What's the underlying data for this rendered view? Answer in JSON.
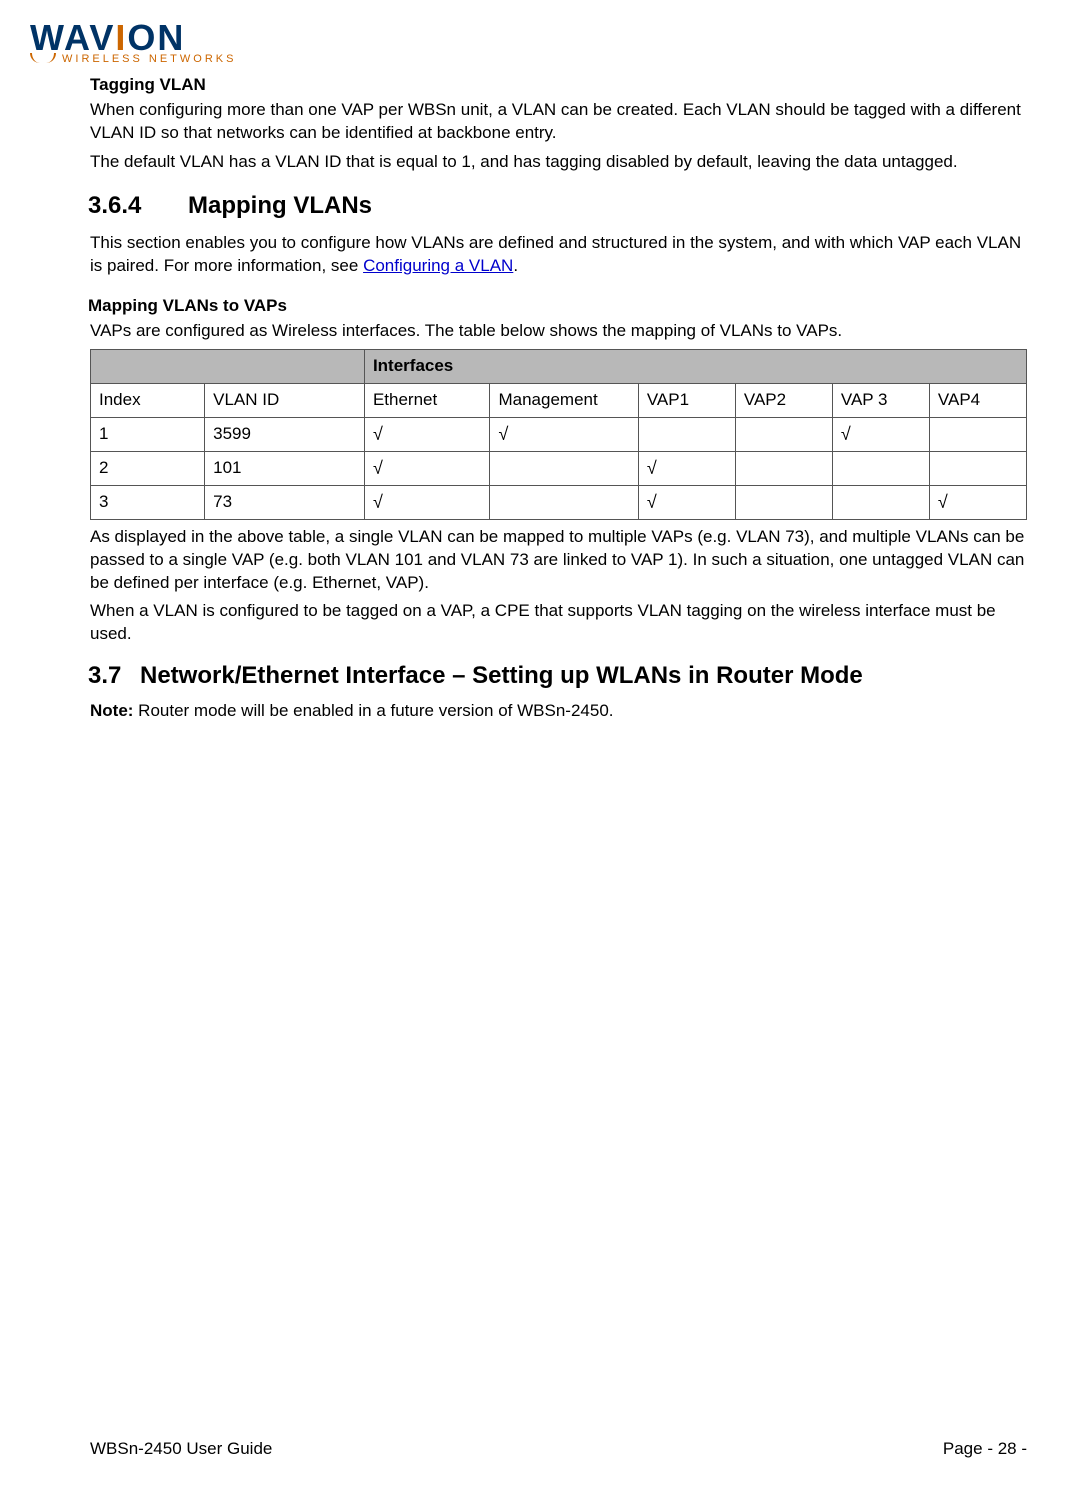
{
  "logo": {
    "brand_part1": "WAV",
    "brand_i": "I",
    "brand_part2": "ON",
    "subtitle": "WIRELESS NETWORKS"
  },
  "tagging": {
    "heading": "Tagging VLAN",
    "p1": "When configuring more than one VAP per WBSn unit, a VLAN can be created. Each VLAN should be tagged with a different VLAN ID so that networks can be identified at backbone entry.",
    "p2": "The default VLAN has a VLAN ID that is equal to 1, and has tagging disabled by default, leaving the data untagged."
  },
  "s364": {
    "num": "3.6.4",
    "title": "Mapping VLANs",
    "p1a": "This section enables you to configure how VLANs are defined and structured in the system, and with which VAP each VLAN is paired. For more information, see ",
    "link": "Configuring a VLAN",
    "p1b": "."
  },
  "mapping": {
    "heading": "Mapping VLANs to VAPs",
    "intro": "VAPs are configured as Wireless interfaces. The table below shows the mapping of VLANs to VAPs.",
    "table": {
      "interfaces_header": "Interfaces",
      "cols": {
        "index": "Index",
        "vlanid": "VLAN ID",
        "ethernet": "Ethernet",
        "management": "Management",
        "vap1": "VAP1",
        "vap2": "VAP2",
        "vap3": "VAP 3",
        "vap4": "VAP4"
      },
      "rows": [
        {
          "index": "1",
          "vlanid": "3599",
          "ethernet": "√",
          "management": "√",
          "vap1": "",
          "vap2": "",
          "vap3": "√",
          "vap4": ""
        },
        {
          "index": "2",
          "vlanid": "101",
          "ethernet": "√",
          "management": "",
          "vap1": "√",
          "vap2": "",
          "vap3": "",
          "vap4": ""
        },
        {
          "index": "3",
          "vlanid": "73",
          "ethernet": "√",
          "management": "",
          "vap1": "√",
          "vap2": "",
          "vap3": "",
          "vap4": "√"
        }
      ]
    },
    "p2": "As displayed in the above table, a single VLAN can be mapped to multiple VAPs (e.g. VLAN 73), and multiple VLANs can be passed to a single VAP (e.g. both VLAN 101 and VLAN 73 are linked to VAP 1). In such a situation, one untagged VLAN can be defined per interface (e.g. Ethernet, VAP).",
    "p3": "When a VLAN is configured to be tagged on a VAP, a CPE that supports VLAN tagging on the wireless interface must be used."
  },
  "s37": {
    "num": "3.7",
    "title": "Network/Ethernet Interface – Setting up WLANs in Router Mode",
    "note_label": "Note:",
    "note_text": " Router mode will be enabled in a future version of WBSn-2450."
  },
  "footer": {
    "left": "WBSn-2450 User Guide",
    "right": "Page - 28 -"
  }
}
